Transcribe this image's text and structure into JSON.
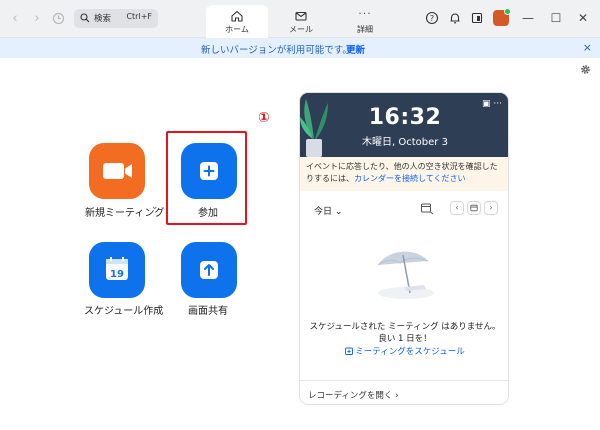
{
  "titlebar": {
    "search_label": "検索",
    "search_shortcut": "Ctrl+F",
    "tabs": [
      {
        "label": "ホーム",
        "icon": "home-icon",
        "active": true
      },
      {
        "label": "メール",
        "icon": "mail-icon",
        "active": false
      },
      {
        "label": "詳細",
        "icon": "more-icon",
        "active": false
      }
    ],
    "more_glyph": "···",
    "icons": [
      "back-icon",
      "forward-icon",
      "history-icon",
      "help-icon",
      "bell-icon",
      "window-icon",
      "avatar",
      "minimize-icon",
      "maximize-icon",
      "close-icon"
    ],
    "win_minimize": "—",
    "win_maximize": "☐",
    "win_close": "✕",
    "back_glyph": "‹",
    "forward_glyph": "›"
  },
  "banner": {
    "text": "新しいバージョンが利用可能です。",
    "link": "更新",
    "close": "×"
  },
  "actions": [
    {
      "label": "新規ミーティング",
      "icon": "video-camera-icon",
      "color": "#f26d21",
      "dropdown": "⌄"
    },
    {
      "label": "参加",
      "icon": "plus-icon",
      "color": "#0e72ed"
    },
    {
      "label": "スケジュール作成",
      "icon": "calendar-icon",
      "color": "#0e72ed",
      "calendar_day": "19"
    },
    {
      "label": "画面共有",
      "icon": "share-arrow-icon",
      "color": "#0e72ed"
    }
  ],
  "annotation": {
    "step": "①",
    "color": "#e8141c"
  },
  "panel": {
    "time": "16:32",
    "date": "木曜日, October 3",
    "hero_icons": "▣ ···",
    "notice_text": "イベントに応答したり、他の人の空き状況を確認したりするには、",
    "notice_link": "カレンダーを接続してください",
    "today_label": "今日 ⌄",
    "nav_prev": "‹",
    "nav_next": "›",
    "empty_line1": "スケジュールされた ミーティング はありません。",
    "empty_line2": "良い 1 日を！",
    "schedule_link": "ミーティングをスケジュール",
    "footer": "レコーディングを開く ›"
  },
  "colors": {
    "accent": "#0b5cff",
    "banner_bg": "#e5f0ff",
    "hero_bg": "#2e3f55",
    "notice_bg": "#fdf5e8"
  }
}
